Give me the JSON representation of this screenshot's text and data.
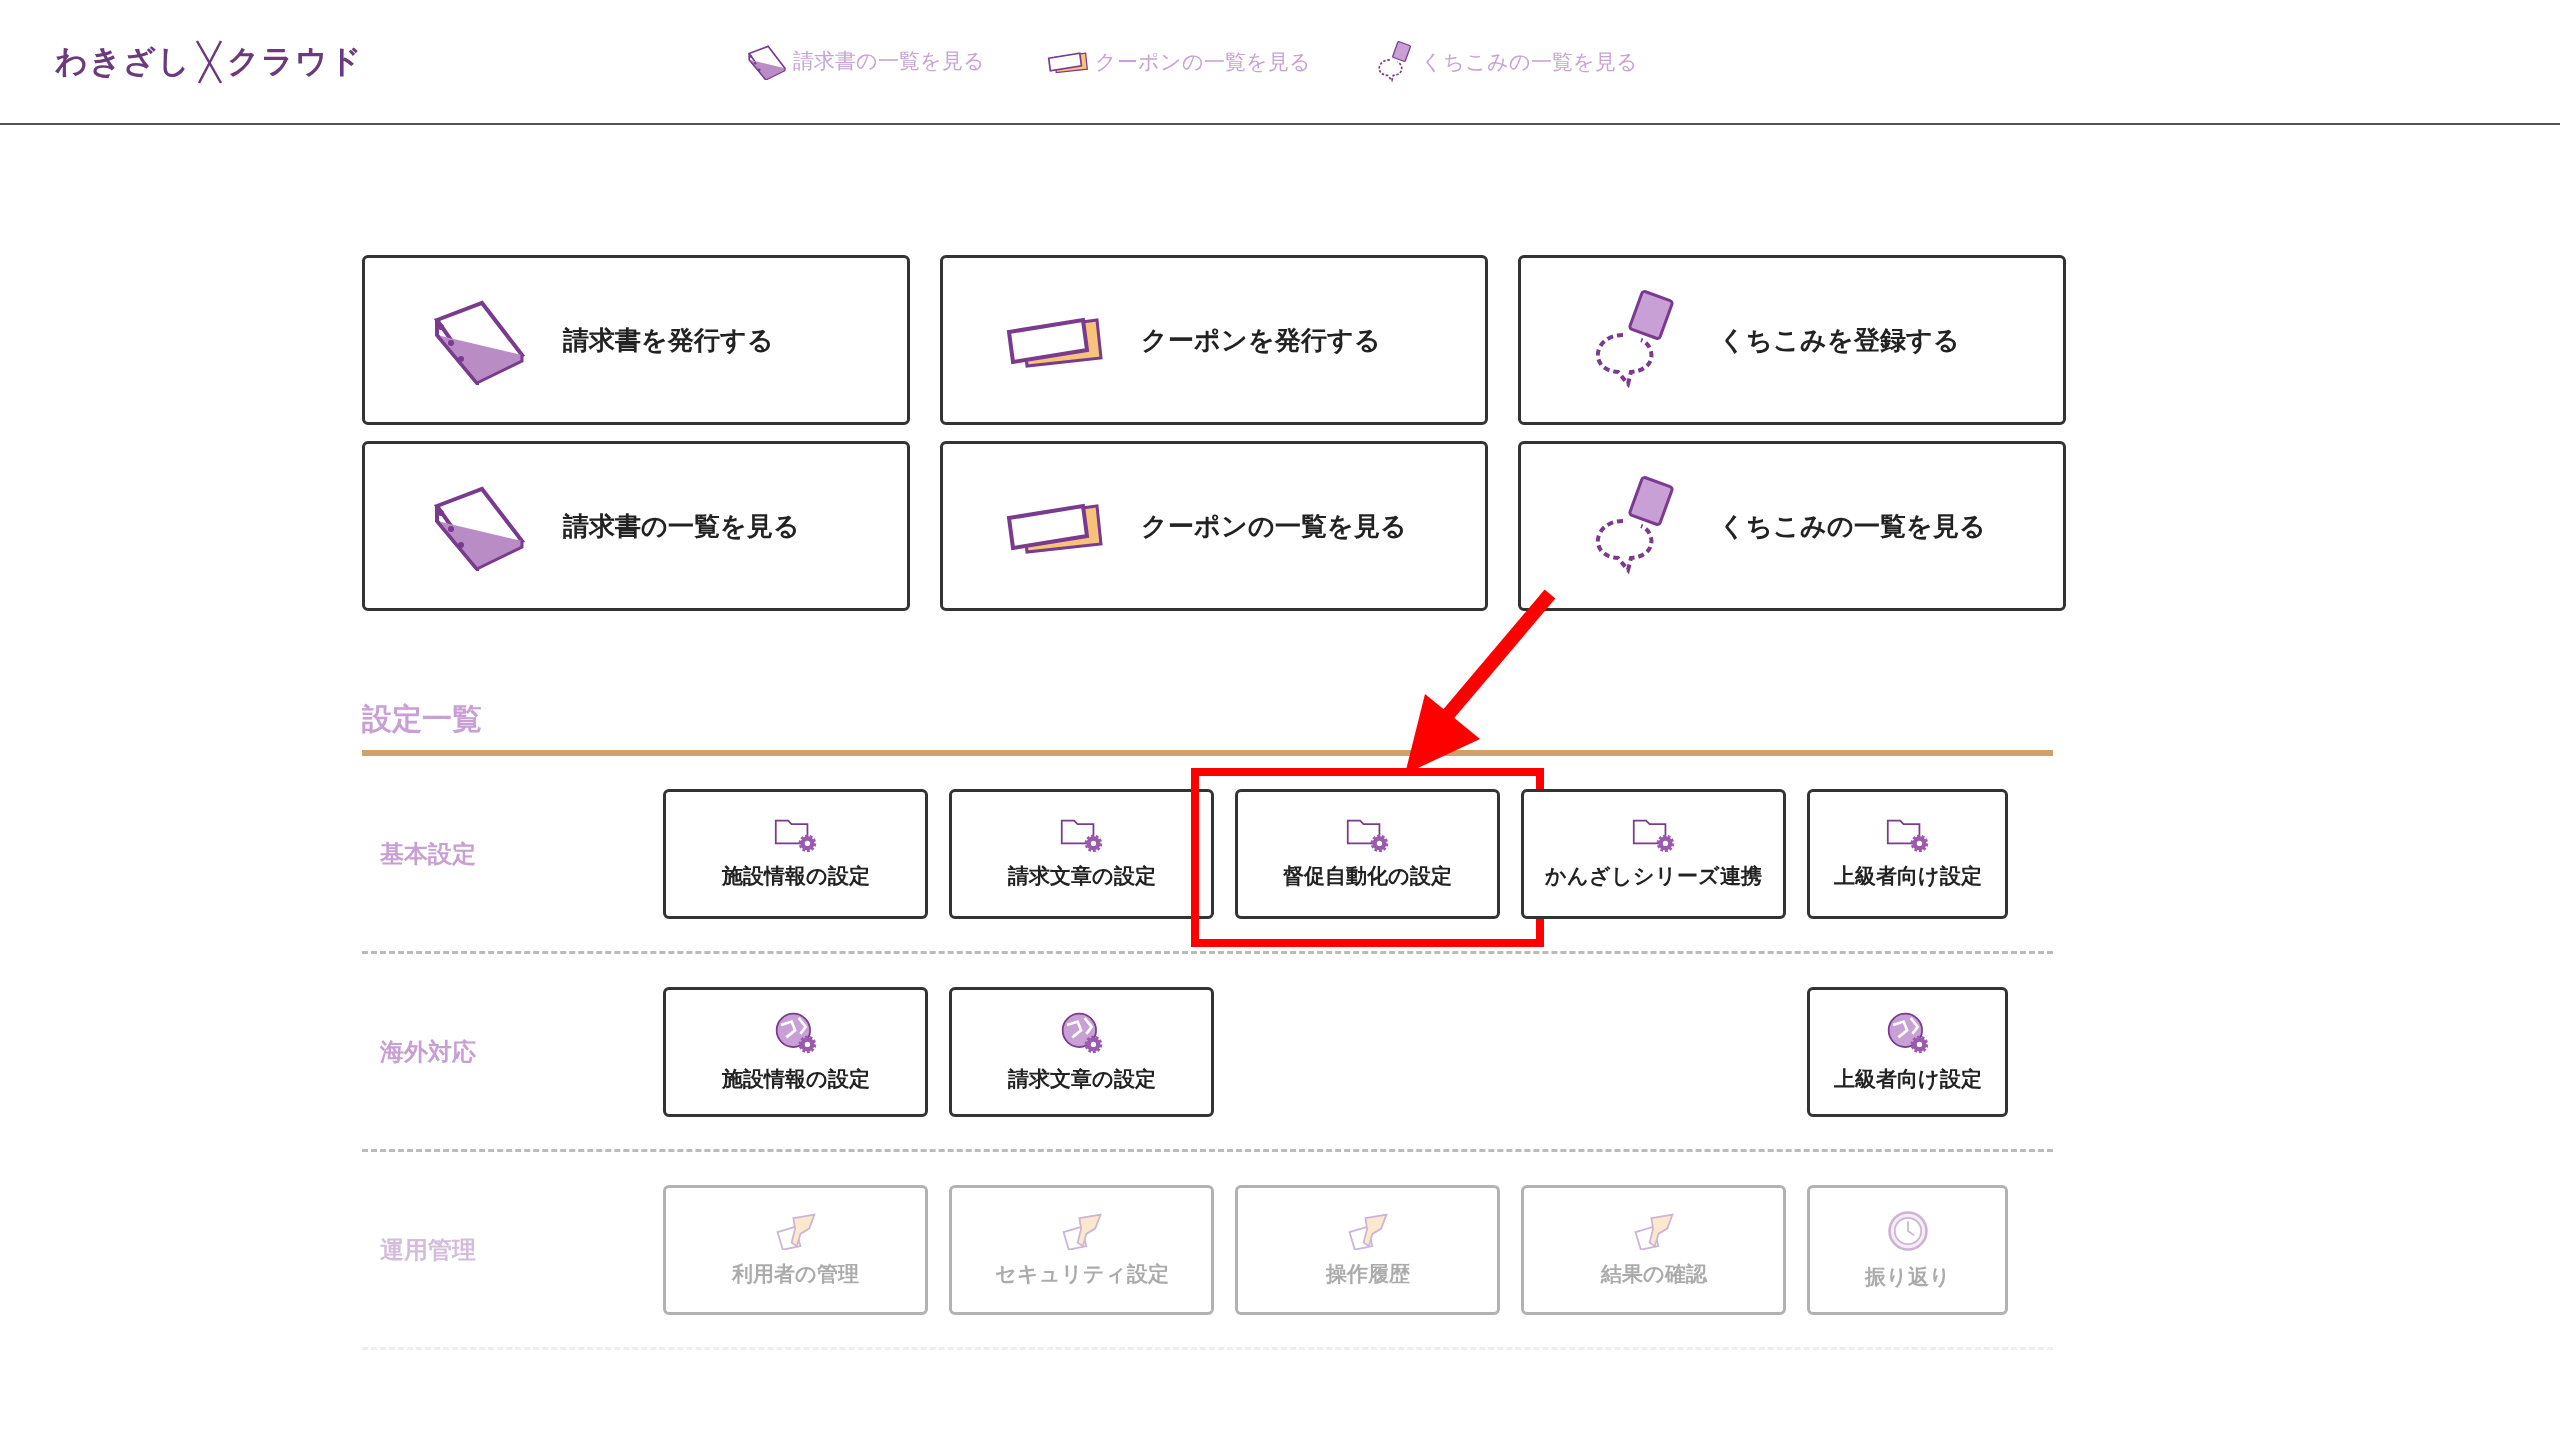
{
  "logo": {
    "left": "わきざし",
    "right": "クラウド"
  },
  "nav": [
    {
      "kind": "book",
      "label": "請求書の一覧を見る"
    },
    {
      "kind": "coupon",
      "label": "クーポンの一覧を見る"
    },
    {
      "kind": "review",
      "label": "くちこみの一覧を見る"
    }
  ],
  "cards": [
    {
      "kind": "book",
      "label": "請求書を発行する"
    },
    {
      "kind": "coupon",
      "label": "クーポンを発行する"
    },
    {
      "kind": "review",
      "label": "くちこみを登録する"
    },
    {
      "kind": "book",
      "label": "請求書の一覧を見る"
    },
    {
      "kind": "coupon",
      "label": "クーポンの一覧を見る"
    },
    {
      "kind": "review",
      "label": "くちこみの一覧を見る"
    }
  ],
  "settings": {
    "title": "設定一覧",
    "sections": [
      {
        "label": "基本設定",
        "faded": false,
        "items": [
          {
            "kind": "folder",
            "label": "施設情報の設定",
            "highlighted": false
          },
          {
            "kind": "folder",
            "label": "請求文章の設定",
            "highlighted": false
          },
          {
            "kind": "folder",
            "label": "督促自動化の設定",
            "highlighted": true
          },
          {
            "kind": "folder",
            "label": "かんざしシリーズ連携",
            "highlighted": false
          },
          {
            "kind": "folder",
            "label": "上級者向け設定",
            "highlighted": false
          }
        ]
      },
      {
        "label": "海外対応",
        "faded": false,
        "items": [
          {
            "kind": "globe",
            "label": "施設情報の設定",
            "highlighted": false
          },
          {
            "kind": "globe",
            "label": "請求文章の設定",
            "highlighted": false
          },
          {
            "kind": "empty"
          },
          {
            "kind": "empty"
          },
          {
            "kind": "globe",
            "label": "上級者向け設定",
            "highlighted": false
          }
        ]
      },
      {
        "label": "運用管理",
        "faded": true,
        "items": [
          {
            "kind": "money",
            "label": "利用者の管理",
            "highlighted": false
          },
          {
            "kind": "money",
            "label": "セキュリティ設定",
            "highlighted": false
          },
          {
            "kind": "money",
            "label": "操作履歴",
            "highlighted": false
          },
          {
            "kind": "money",
            "label": "結果の確認",
            "highlighted": false
          },
          {
            "kind": "clock",
            "label": "振り返り",
            "highlighted": false
          }
        ]
      }
    ]
  }
}
